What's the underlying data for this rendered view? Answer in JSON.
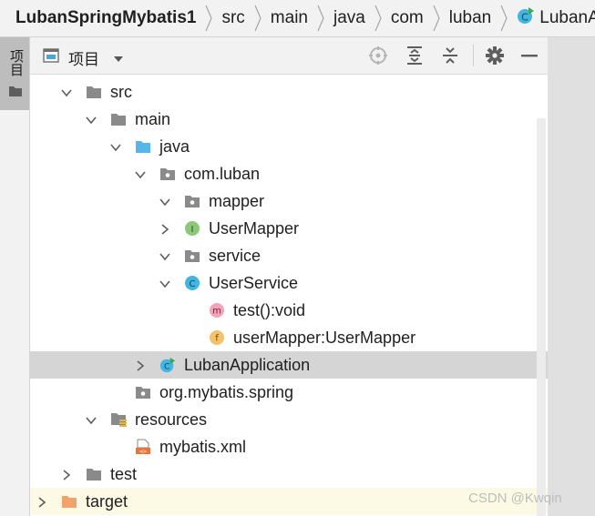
{
  "breadcrumb": {
    "items": [
      "LubanSpringMybatis1",
      "src",
      "main",
      "java",
      "com",
      "luban",
      "LubanAp"
    ]
  },
  "left_strip": {
    "tab_label": "项目"
  },
  "toolbar": {
    "view_label": "项目",
    "buttons": [
      "locate-icon",
      "expand-all-icon",
      "collapse-all-icon",
      "settings-icon",
      "hide-icon"
    ]
  },
  "tree": {
    "rows": [
      {
        "label": "src",
        "icon": "folder",
        "chevron": "down",
        "selected": false
      },
      {
        "label": "main",
        "icon": "folder",
        "chevron": "down",
        "selected": false
      },
      {
        "label": "java",
        "icon": "source-folder",
        "chevron": "down",
        "selected": false
      },
      {
        "label": "com.luban",
        "icon": "package",
        "chevron": "down",
        "selected": false
      },
      {
        "label": "mapper",
        "icon": "package",
        "chevron": "down",
        "selected": false
      },
      {
        "label": "UserMapper",
        "icon": "interface",
        "chevron": "right",
        "selected": false
      },
      {
        "label": "service",
        "icon": "package",
        "chevron": "down",
        "selected": false
      },
      {
        "label": "UserService",
        "icon": "class",
        "chevron": "down",
        "selected": false
      },
      {
        "label": "test():void",
        "icon": "method",
        "chevron": "none",
        "selected": false
      },
      {
        "label": "userMapper:UserMapper",
        "icon": "field",
        "chevron": "none",
        "selected": false
      },
      {
        "label": "LubanApplication",
        "icon": "spring-class",
        "chevron": "right",
        "selected": true
      },
      {
        "label": "org.mybatis.spring",
        "icon": "package",
        "chevron": "none",
        "selected": false
      },
      {
        "label": "resources",
        "icon": "resources-folder",
        "chevron": "down",
        "selected": false
      },
      {
        "label": "mybatis.xml",
        "icon": "xml-file",
        "chevron": "none",
        "selected": false
      },
      {
        "label": "test",
        "icon": "folder",
        "chevron": "right",
        "selected": false
      },
      {
        "label": "target",
        "icon": "excluded-folder",
        "chevron": "right",
        "selected": false
      }
    ]
  },
  "watermark": "CSDN @Kwqin",
  "colors": {
    "selection": "#d5d5d5",
    "highlight_row": "#fcfae4",
    "class_icon": "#40b6e0",
    "interface_icon": "#8cc879",
    "method_icon": "#f5a3b8",
    "field_icon": "#f4c26a",
    "excluded_folder": "#f0a36a",
    "source_folder": "#56b6e6"
  }
}
